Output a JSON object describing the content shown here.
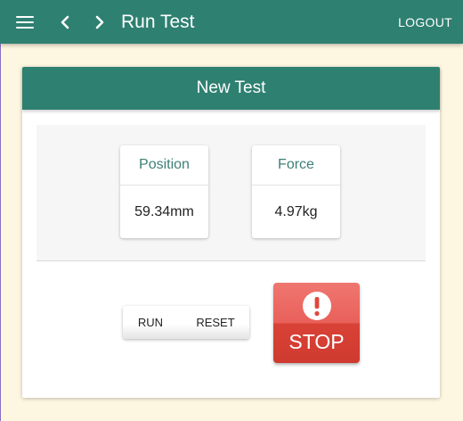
{
  "app_bar": {
    "title": "Run Test",
    "logout_label": "LOGOUT",
    "menu_icon": "hamburger-menu-icon",
    "back_icon": "chevron-left-icon",
    "forward_icon": "chevron-right-icon",
    "color": "#2e8071"
  },
  "card": {
    "title": "New Test",
    "readings": [
      {
        "label": "Position",
        "value": "59.34mm"
      },
      {
        "label": "Force",
        "value": "4.97kg"
      }
    ],
    "actions": {
      "run_label": "RUN",
      "reset_label": "RESET",
      "stop_label": "STOP",
      "stop_icon": "exclamation-circle-icon",
      "stop_color": "#d94236"
    }
  },
  "colors": {
    "background": "#fdf6e1",
    "accent": "#2e8071",
    "label_text": "#3d7f77"
  }
}
